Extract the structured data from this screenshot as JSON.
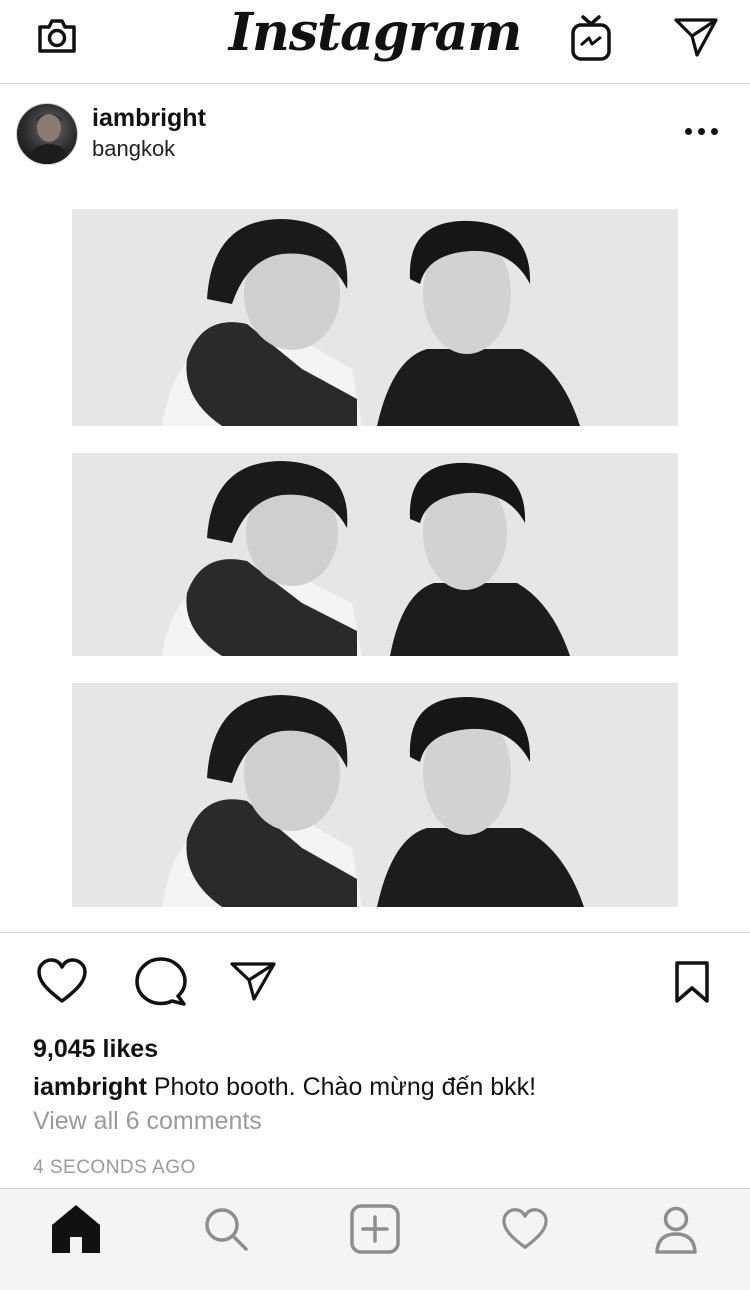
{
  "app": {
    "brand": "Instagram"
  },
  "header": {
    "camera_icon": "camera-icon",
    "igtv_icon": "igtv-icon",
    "direct_icon": "paper-plane-icon"
  },
  "post": {
    "username": "iambright",
    "location": "bangkok",
    "photo_count": 3,
    "likes": "9,045 likes",
    "caption_user": "iambright",
    "caption_text": "Photo booth. Chào mừng đến bkk!",
    "view_comments": "View all 6 comments",
    "timestamp": "4 SECONDS AGO"
  },
  "bottom_nav": {
    "items": [
      "home-icon",
      "search-icon",
      "new-post-icon",
      "activity-icon",
      "profile-icon"
    ],
    "active": "home-icon"
  },
  "colors": {
    "text": "#111111",
    "muted": "#9a9a9a",
    "divider": "#d8d8d8",
    "nav_bg": "#f4f4f6"
  }
}
